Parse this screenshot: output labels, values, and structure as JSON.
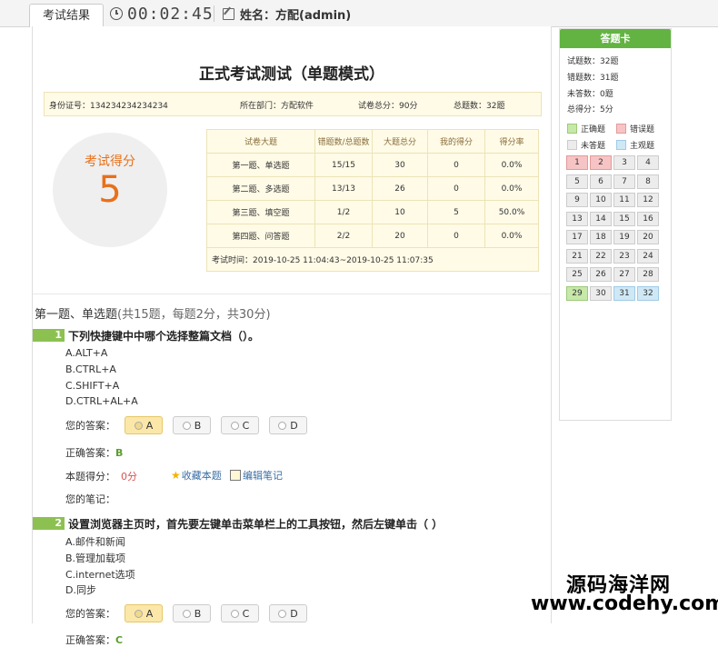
{
  "topbar": {
    "tab_label": "考试结果",
    "timer": "00:02:45",
    "user_label": "姓名：方配(admin)"
  },
  "exam": {
    "title": "正式考试测试（单题模式）",
    "info": {
      "id": "身份证号：134234234234234",
      "dept": "所在部门：方配软件",
      "total_score": "试卷总分：90分",
      "total_questions": "总题数：32题"
    },
    "score_label": "考试得分",
    "score_value": "5"
  },
  "stats_table": {
    "headers": [
      "试卷大题",
      "错题数/总题数",
      "大题总分",
      "我的得分",
      "得分率"
    ],
    "rows": [
      [
        "第一题、单选题",
        "15/15",
        "30",
        "0",
        "0.0%"
      ],
      [
        "第二题、多选题",
        "13/13",
        "26",
        "0",
        "0.0%"
      ],
      [
        "第三题、填空题",
        "1/2",
        "10",
        "5",
        "50.0%"
      ],
      [
        "第四题、问答题",
        "2/2",
        "20",
        "0",
        "0.0%"
      ]
    ],
    "time": "考试时间：2019-10-25 11:04:43~2019-10-25 11:07:35"
  },
  "section": {
    "title": "第一题、单选题",
    "subtitle": "(共15题，每题2分，共30分)"
  },
  "questions": [
    {
      "num": "1",
      "text": "下列快捷键中中哪个选择整篇文档（）。",
      "options": [
        "A.ALT+A",
        "B.CTRL+A",
        "C.SHIFT+A",
        "D.CTRL+AL+A"
      ],
      "answer_label": "您的答案：",
      "buttons": [
        "A",
        "B",
        "C",
        "D"
      ],
      "selected": "A",
      "correct_label": "正确答案：",
      "correct": "B",
      "score_label": "本题得分：",
      "score": "0分",
      "fav_label": "收藏本题",
      "edit_label": "编辑笔记",
      "notes_label": "您的笔记："
    },
    {
      "num": "2",
      "text": "设置浏览器主页时，首先要左键单击菜单栏上的工具按钮，然后左键单击（ ）",
      "options": [
        "A.邮件和新闻",
        "B.管理加载项",
        "C.internet选项",
        "D.同步"
      ],
      "answer_label": "您的答案：",
      "buttons": [
        "A",
        "B",
        "C",
        "D"
      ],
      "selected": "A",
      "correct_label": "正确答案：",
      "correct": "C"
    }
  ],
  "answer_card": {
    "header": "答题卡",
    "stats": [
      "试题数：32题",
      "错题数：31题",
      "未答数：0题",
      "总得分：5分"
    ],
    "legend": [
      "正确题",
      "错误题",
      "未答题",
      "主观题"
    ],
    "colors": {
      "right": "#c6e8a8",
      "wrong": "#f6c4c4",
      "unanswered": "#ececec",
      "subjective": "#cfe8f6"
    },
    "cells": [
      {
        "n": "1",
        "s": "wrong"
      },
      {
        "n": "2",
        "s": "wrong"
      },
      {
        "n": "3",
        "s": "none"
      },
      {
        "n": "4",
        "s": "none"
      },
      {
        "n": "5",
        "s": "none"
      },
      {
        "n": "6",
        "s": "none"
      },
      {
        "n": "7",
        "s": "none"
      },
      {
        "n": "8",
        "s": "none"
      },
      {
        "n": "9",
        "s": "none"
      },
      {
        "n": "10",
        "s": "none"
      },
      {
        "n": "11",
        "s": "none"
      },
      {
        "n": "12",
        "s": "none"
      },
      {
        "n": "13",
        "s": "none"
      },
      {
        "n": "14",
        "s": "none"
      },
      {
        "n": "15",
        "s": "none"
      },
      {
        "n": "16",
        "s": "none"
      },
      {
        "n": "17",
        "s": "none"
      },
      {
        "n": "18",
        "s": "none"
      },
      {
        "n": "19",
        "s": "none"
      },
      {
        "n": "20",
        "s": "none"
      },
      {
        "n": "21",
        "s": "none"
      },
      {
        "n": "22",
        "s": "none"
      },
      {
        "n": "23",
        "s": "none"
      },
      {
        "n": "24",
        "s": "none"
      },
      {
        "n": "25",
        "s": "none"
      },
      {
        "n": "26",
        "s": "none"
      },
      {
        "n": "27",
        "s": "none"
      },
      {
        "n": "28",
        "s": "none"
      },
      {
        "n": "29",
        "s": "right"
      },
      {
        "n": "30",
        "s": "none"
      },
      {
        "n": "31",
        "s": "subj"
      },
      {
        "n": "32",
        "s": "subj"
      }
    ]
  },
  "watermark": {
    "line1": "源码海洋网",
    "line2": "www.codehy.com"
  }
}
